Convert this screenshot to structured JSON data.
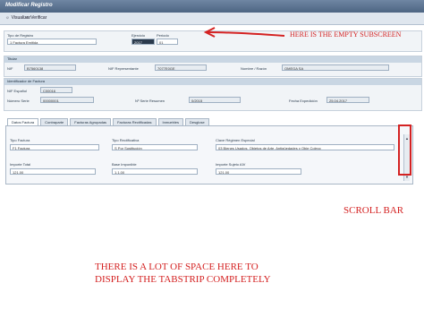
{
  "window": {
    "title": "Modificar Registro"
  },
  "toolbar": {
    "visualizar": "Visualizar",
    "verificar": "Verificar"
  },
  "header": {
    "tipo_registro_label": "Tipo de Registro",
    "tipo_registro_value": "1 Factura Emitida",
    "ejercicio_label": "Ejercicio",
    "ejercicio_value": "2017",
    "periodo_label": "Periodo",
    "periodo_value": "01"
  },
  "titular": {
    "section": "Titular",
    "nif_label": "NIF",
    "nif_value": "B7560138",
    "nif_rep_label": "NIF Representante",
    "nif_rep_value": "7077E0GE",
    "nombre_label": "Nombre / Razón",
    "nombre_value": "OMEGA SA"
  },
  "identificador": {
    "section": "Identificador de Factura",
    "nif_espanol_label": "NIF Español",
    "nif_espanol_value": "C00016",
    "numero_serie_label": "Número Serie",
    "numero_serie_value": "00000001",
    "nf_resumen_label": "Nº Serie Resumen",
    "nf_resumen_value": "0/2015",
    "fecha_label": "Fecha Expedición",
    "fecha_value": "25.04.2017"
  },
  "tabs": [
    "Datos Factura",
    "Contraparte",
    "Facturas Agrupadas",
    "Facturas Rectificadas",
    "Inmuebles",
    "Desglose"
  ],
  "datos_factura": {
    "tipo_factura_label": "Tipo Factura",
    "tipo_factura_value": "F1 Factura",
    "tipo_rect_label": "Tipo Rectificativa",
    "tipo_rect_value": "S Por Sustitución",
    "clave_label": "Clave Régimen Especial",
    "clave_value": "03 Bienes Usados, Objetos de Arte, Antigüedades y Obje Colecc",
    "importe_total_label": "Importe Total",
    "importe_total_value": "121,00",
    "base_label": "Base Imponible",
    "base_value": "1.1.00",
    "importe_ajuste_label": "Importe Sujeto AIV",
    "importe_ajuste_value": "121,00"
  },
  "annotations": {
    "empty_subscreen": "HERE IS THE EMPTY SUBSCREEN",
    "scroll_bar": "SCROLL BAR",
    "space_line1": "THERE IS A LOT OF SPACE HERE TO",
    "space_line2": "DISPLAY THE TABSTRIP COMPLETELY"
  },
  "colors": {
    "annotation": "#d42222",
    "sap_header": "#4d6582"
  }
}
